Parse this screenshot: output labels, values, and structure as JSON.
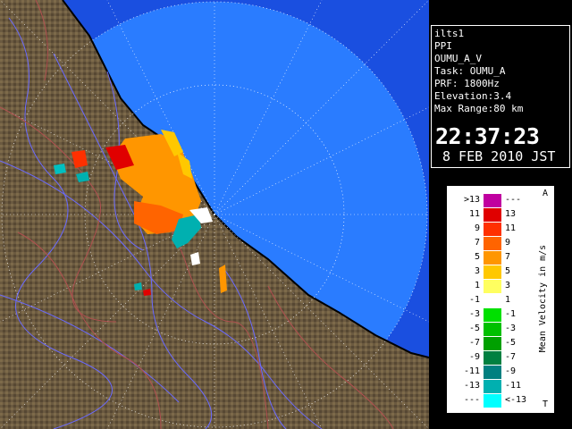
{
  "info": {
    "lines": [
      "ilts1",
      "PPI",
      "OUMU_A_V",
      "Task: OUMU_A",
      "PRF: 1800Hz",
      "Elevation:3.4",
      "Max Range:80 km"
    ],
    "time": "22:37:23",
    "date": "8 FEB 2010 JST"
  },
  "legend": {
    "title": "Mean Velocity in m/s",
    "corner_top": "A",
    "corner_bottom": "T",
    "rows": [
      {
        "left": ">13",
        "right": "---",
        "color": "#c000a0"
      },
      {
        "left": "11",
        "right": "13",
        "color": "#e00000"
      },
      {
        "left": "9",
        "right": "11",
        "color": "#ff3000"
      },
      {
        "left": "7",
        "right": "9",
        "color": "#ff6400"
      },
      {
        "left": "5",
        "right": "7",
        "color": "#ff9600"
      },
      {
        "left": "3",
        "right": "5",
        "color": "#ffc800"
      },
      {
        "left": "1",
        "right": "3",
        "color": "#ffff60"
      },
      {
        "left": "-1",
        "right": "1",
        "color": "#ffffff"
      },
      {
        "left": "-3",
        "right": "-1",
        "color": "#00e000"
      },
      {
        "left": "-5",
        "right": "-3",
        "color": "#00c000"
      },
      {
        "left": "-7",
        "right": "-5",
        "color": "#00a000"
      },
      {
        "left": "-9",
        "right": "-7",
        "color": "#008040"
      },
      {
        "left": "-11",
        "right": "-9",
        "color": "#008080"
      },
      {
        "left": "-13",
        "right": "-11",
        "color": "#00b0b0"
      },
      {
        "left": "---",
        "right": "<-13",
        "color": "#00ffff"
      }
    ]
  },
  "colors": {
    "sea_outer": "#1a4fe0",
    "sea_inner": "#2a7cff",
    "land": "#6b5a40"
  }
}
